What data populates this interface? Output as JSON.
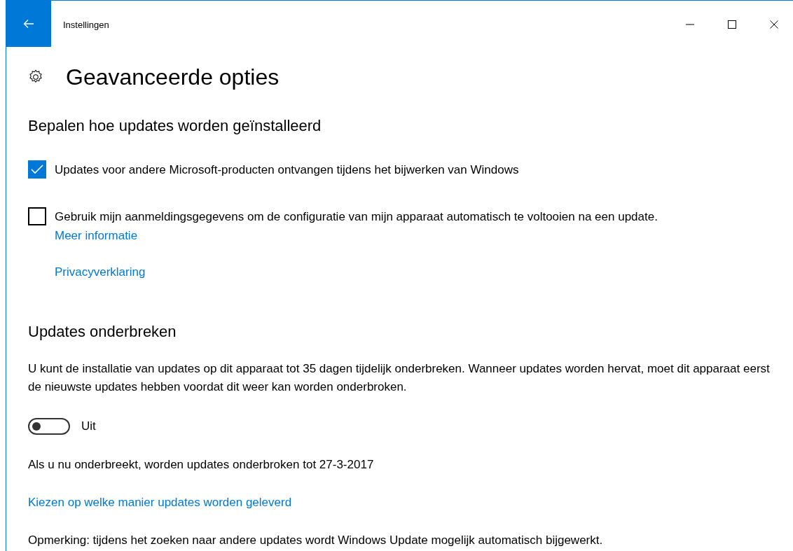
{
  "window": {
    "title": "Instellingen"
  },
  "page": {
    "title": "Geavanceerde opties"
  },
  "sections": [
    {
      "heading": "Bepalen hoe updates worden geïnstalleerd",
      "items": [
        {
          "kind": "checkbox",
          "label": "Updates voor andere Microsoft-producten ontvangen tijdens het bijwerken van Windows",
          "checked": true
        },
        {
          "kind": "checkbox",
          "label": "Gebruik mijn aanmeldingsgegevens om de configuratie van mijn apparaat automatisch te voltooien na een update.",
          "checked": false,
          "link": "Meer informatie"
        },
        {
          "kind": "link",
          "label": "Privacyverklaring"
        }
      ]
    },
    {
      "heading": "Updates onderbreken",
      "items": [
        {
          "kind": "text",
          "label": "U kunt de installatie van updates op dit apparaat tot 35 dagen tijdelijk onderbreken. Wanneer updates worden hervat, moet dit apparaat eerst de nieuwste updates hebben voordat dit weer kan worden onderbroken."
        },
        {
          "kind": "toggle",
          "label": "Uit",
          "on": false
        },
        {
          "kind": "text",
          "label": "Als u nu onderbreekt, worden updates onderbroken tot 27-3-2017"
        },
        {
          "kind": "link",
          "label": "Kiezen op welke manier updates worden geleverd"
        },
        {
          "kind": "text",
          "label": "Opmerking: tijdens het zoeken naar andere updates wordt Windows Update mogelijk automatisch bijgewerkt."
        }
      ]
    }
  ]
}
